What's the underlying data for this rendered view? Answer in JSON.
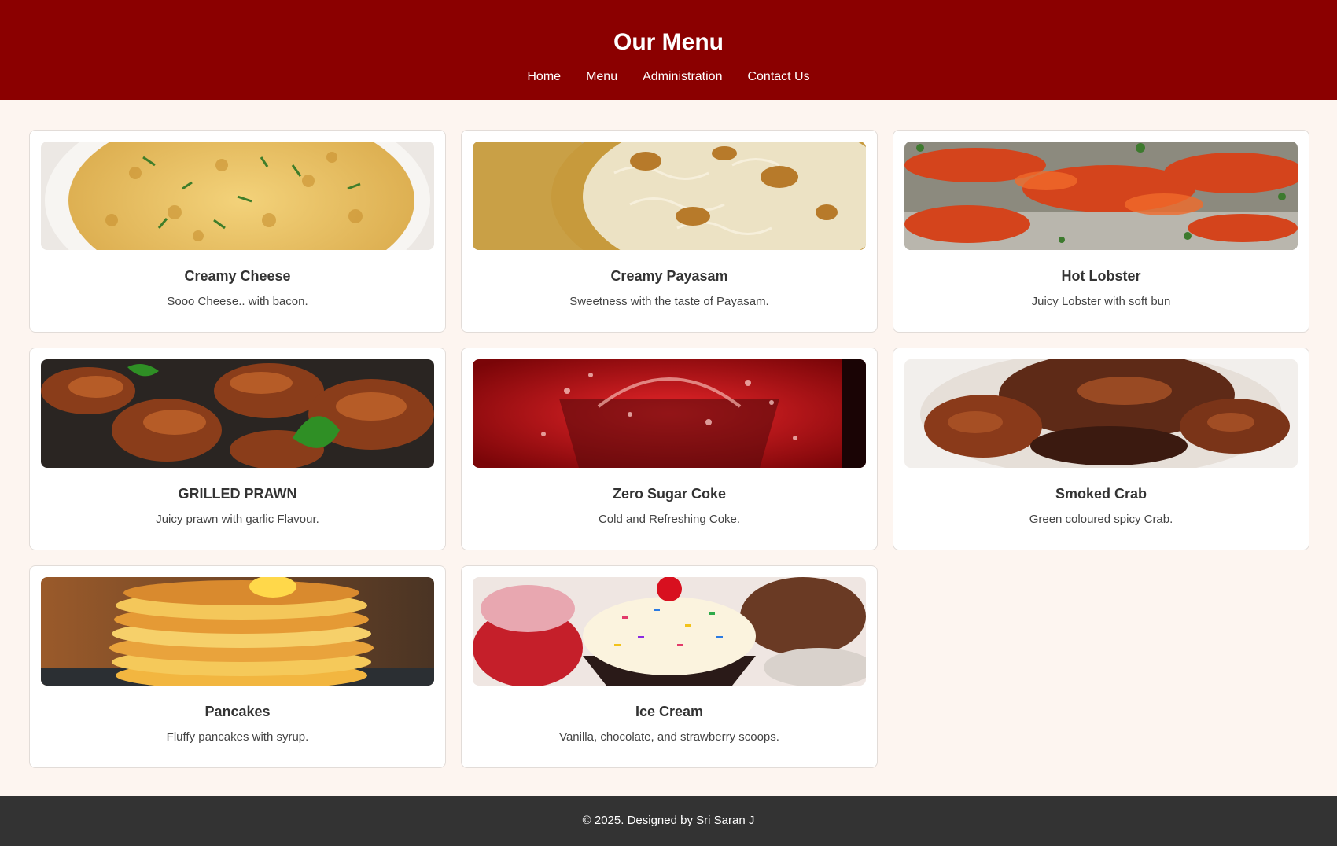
{
  "header": {
    "title": "Our Menu",
    "nav": [
      "Home",
      "Menu",
      "Administration",
      "Contact Us"
    ]
  },
  "menu_items": [
    {
      "name": "Creamy Cheese",
      "description": "Sooo Cheese.. with bacon.",
      "image_icon": "mac-and-cheese-photo"
    },
    {
      "name": "Creamy Payasam",
      "description": "Sweetness with the taste of Payasam.",
      "image_icon": "payasam-photo"
    },
    {
      "name": "Hot Lobster",
      "description": "Juicy Lobster with soft bun",
      "image_icon": "lobster-photo"
    },
    {
      "name": "GRILLED PRAWN",
      "description": "Juicy prawn with garlic Flavour.",
      "image_icon": "prawn-photo"
    },
    {
      "name": "Zero Sugar Coke",
      "description": "Cold and Refreshing Coke.",
      "image_icon": "coke-photo"
    },
    {
      "name": "Smoked Crab",
      "description": "Green coloured spicy Crab.",
      "image_icon": "crab-photo"
    },
    {
      "name": "Pancakes",
      "description": "Fluffy pancakes with syrup.",
      "image_icon": "pancakes-photo"
    },
    {
      "name": "Ice Cream",
      "description": "Vanilla, chocolate, and strawberry scoops.",
      "image_icon": "ice-cream-photo"
    }
  ],
  "footer": {
    "text": "© 2025. Designed by Sri Saran J"
  },
  "colors": {
    "header_bg": "#8b0000",
    "page_bg": "#fdf5f0",
    "footer_bg": "#333333"
  }
}
